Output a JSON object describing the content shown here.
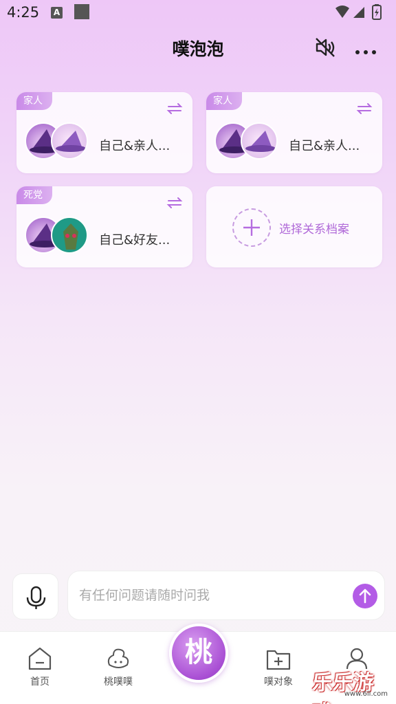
{
  "status": {
    "time": "4:25",
    "a_label": "A"
  },
  "header": {
    "title": "噗泡泡",
    "mute_icon": "speaker-mute-icon",
    "more_icon": "more-dots-icon"
  },
  "cards": [
    {
      "tag": "家人",
      "label": "自己&亲人..."
    },
    {
      "tag": "家人",
      "label": "自己&亲人..."
    },
    {
      "tag": "死党",
      "label": "自己&好友..."
    }
  ],
  "add_card": {
    "label": "选择关系档案"
  },
  "input": {
    "placeholder": "有任何问题请随时问我"
  },
  "tabs": {
    "home": "首页",
    "peach": "桃噗噗",
    "center": "桃",
    "objects": "噗对象",
    "profile": ""
  },
  "watermark": {
    "text": "乐乐游戏",
    "url": "www.6ll.com"
  },
  "colors": {
    "accent": "#b35ce6",
    "tag": "#c98ae8"
  }
}
